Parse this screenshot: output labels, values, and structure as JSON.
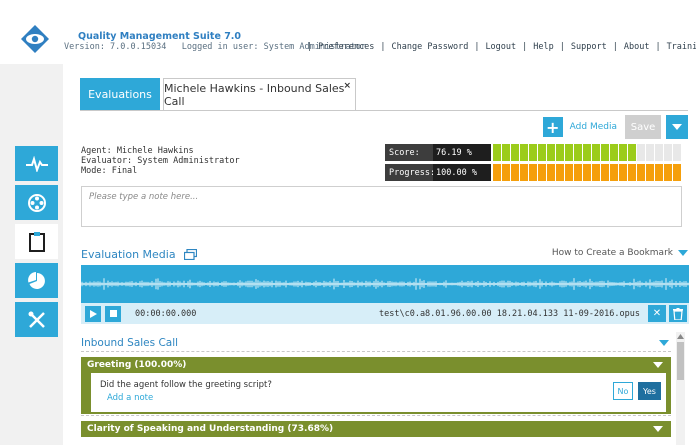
{
  "header": {
    "app_title": "Quality Management Suite 7.0",
    "version_text": "Version: 7.0.0.15034",
    "logged_in_text": "Logged in user: System Administrator",
    "nav": [
      "Preferences",
      "Change Password",
      "Logout",
      "Help",
      "Support",
      "About",
      "Training"
    ]
  },
  "sidebar": {
    "items": [
      {
        "icon": "pulse-icon",
        "active": false
      },
      {
        "icon": "film-reel-icon",
        "active": false
      },
      {
        "icon": "clipboard-icon",
        "active": true
      },
      {
        "icon": "pie-chart-icon",
        "active": false
      },
      {
        "icon": "tools-icon",
        "active": false
      }
    ]
  },
  "tabs": {
    "evaluations": "Evaluations",
    "call": "Michele Hawkins - Inbound Sales Call",
    "close": "×"
  },
  "toolbar": {
    "add_media": "Add Media",
    "save": "Save"
  },
  "meta": {
    "agent": "Agent: Michele Hawkins",
    "evaluator": "Evaluator: System Administrator",
    "mode": "Mode: Final"
  },
  "scores": {
    "score_label": "Score:",
    "score_value": "76.19 %",
    "score_fraction": 0.7619,
    "progress_label": "Progress:",
    "progress_value": "100.00 %",
    "progress_fraction": 1.0
  },
  "colors": {
    "accent": "#2ea8d8",
    "score_fill": "#9ccc1b",
    "progress_fill": "#f59f0b",
    "category": "#7a8f2d"
  },
  "note": {
    "placeholder": "Please type a note here..."
  },
  "media": {
    "title": "Evaluation Media",
    "bookmark_link": "How to Create a Bookmark",
    "time": "00:00:00.000",
    "filename": "test\\c0.a8.01.96.00.00 18.21.04.133 11-09-2016.opus"
  },
  "form": {
    "title": "Inbound Sales Call",
    "category1": "Greeting (100.00%)",
    "question1": "Did the agent follow the greeting script?",
    "add_note": "Add a note",
    "no": "No",
    "yes": "Yes",
    "category2": "Clarity of Speaking and Understanding (73.68%)"
  }
}
